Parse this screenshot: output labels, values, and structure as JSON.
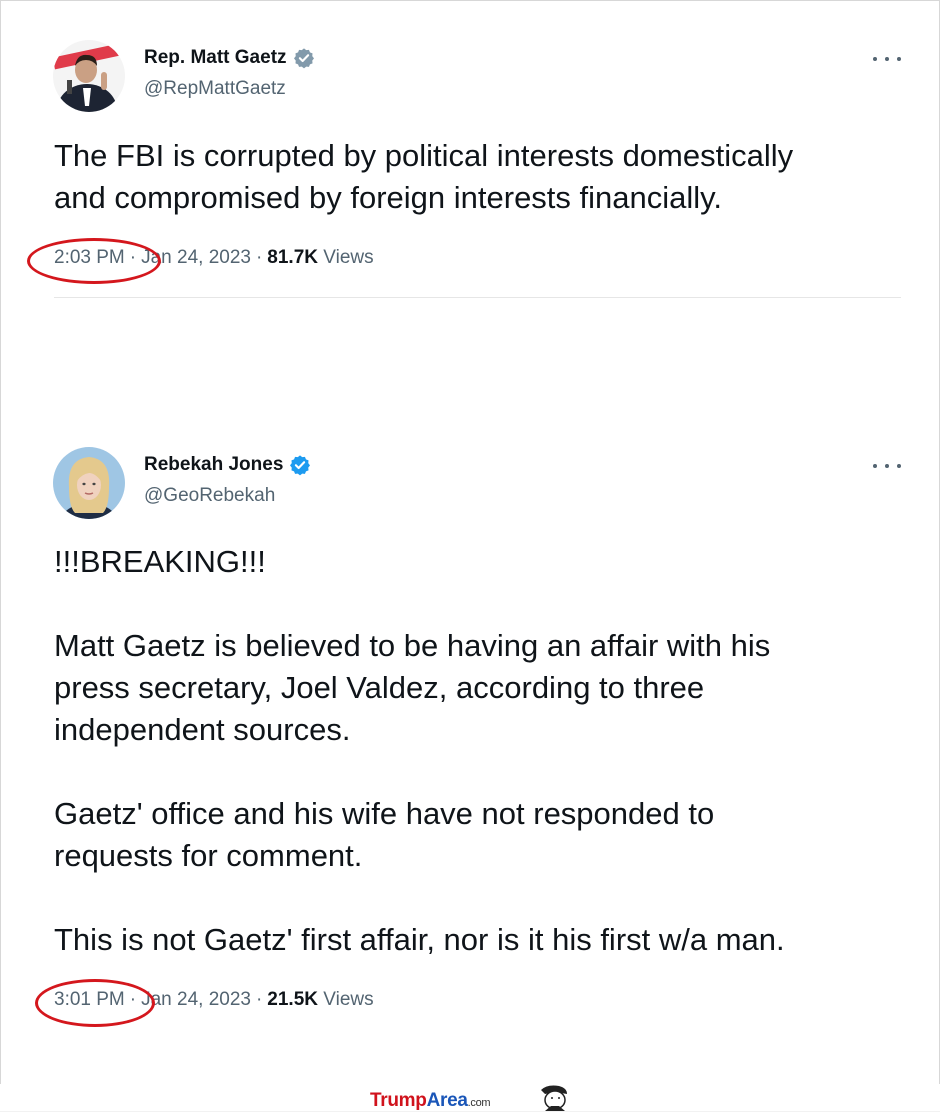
{
  "colors": {
    "accent_red": "#d4171d",
    "verified_blue": "#1d9bf0",
    "muted": "#536471"
  },
  "tweets": [
    {
      "name": "Rep. Matt Gaetz",
      "handle": "@RepMattGaetz",
      "text": "The FBI is corrupted by political interests domestically\nand compromised by foreign interests financially.",
      "time": "2:03 PM",
      "date": "Jan 24, 2023",
      "views_count": "81.7K",
      "views_label": "Views",
      "verified_icon": "verified-badge-gray",
      "more_icon": "more-horizontal-icon"
    },
    {
      "name": "Rebekah Jones",
      "handle": "@GeoRebekah",
      "text": "!!!BREAKING!!!\n\nMatt Gaetz is believed to be having an affair with his\npress secretary, Joel Valdez, according to three\nindependent sources.\n\nGaetz' office and his wife have not responded to\nrequests for comment.\n\nThis is not Gaetz' first affair, nor is it his first w/a man.",
      "time": "3:01 PM",
      "date": "Jan 24, 2023",
      "views_count": "21.5K",
      "views_label": "Views",
      "verified_icon": "verified-badge-blue",
      "more_icon": "more-horizontal-icon"
    }
  ],
  "footer": {
    "brand_part1": "Trump",
    "brand_part2": "Area",
    "brand_suffix": ".com"
  }
}
